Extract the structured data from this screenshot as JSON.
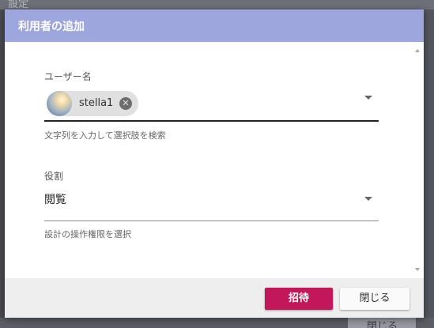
{
  "background": {
    "title": "設定",
    "close_label": "閉じる"
  },
  "dialog": {
    "title": "利用者の追加",
    "header_color": "#9ea7dd"
  },
  "user_field": {
    "label": "ユーザー名",
    "selected_chips": [
      {
        "name": "stella1"
      }
    ],
    "hint": "文字列を入力して選択肢を検索"
  },
  "role_field": {
    "label": "役割",
    "value": "閲覧",
    "hint": "設計の操作権限を選択"
  },
  "footer": {
    "invite_label": "招待",
    "close_label": "閉じる",
    "invite_color": "#c2185b"
  },
  "icons": {
    "chip_remove": "close-circle-icon",
    "dropdown": "caret-down-icon",
    "scroll_up": "scroll-up-arrow-icon",
    "scroll_down": "scroll-down-arrow-icon"
  }
}
